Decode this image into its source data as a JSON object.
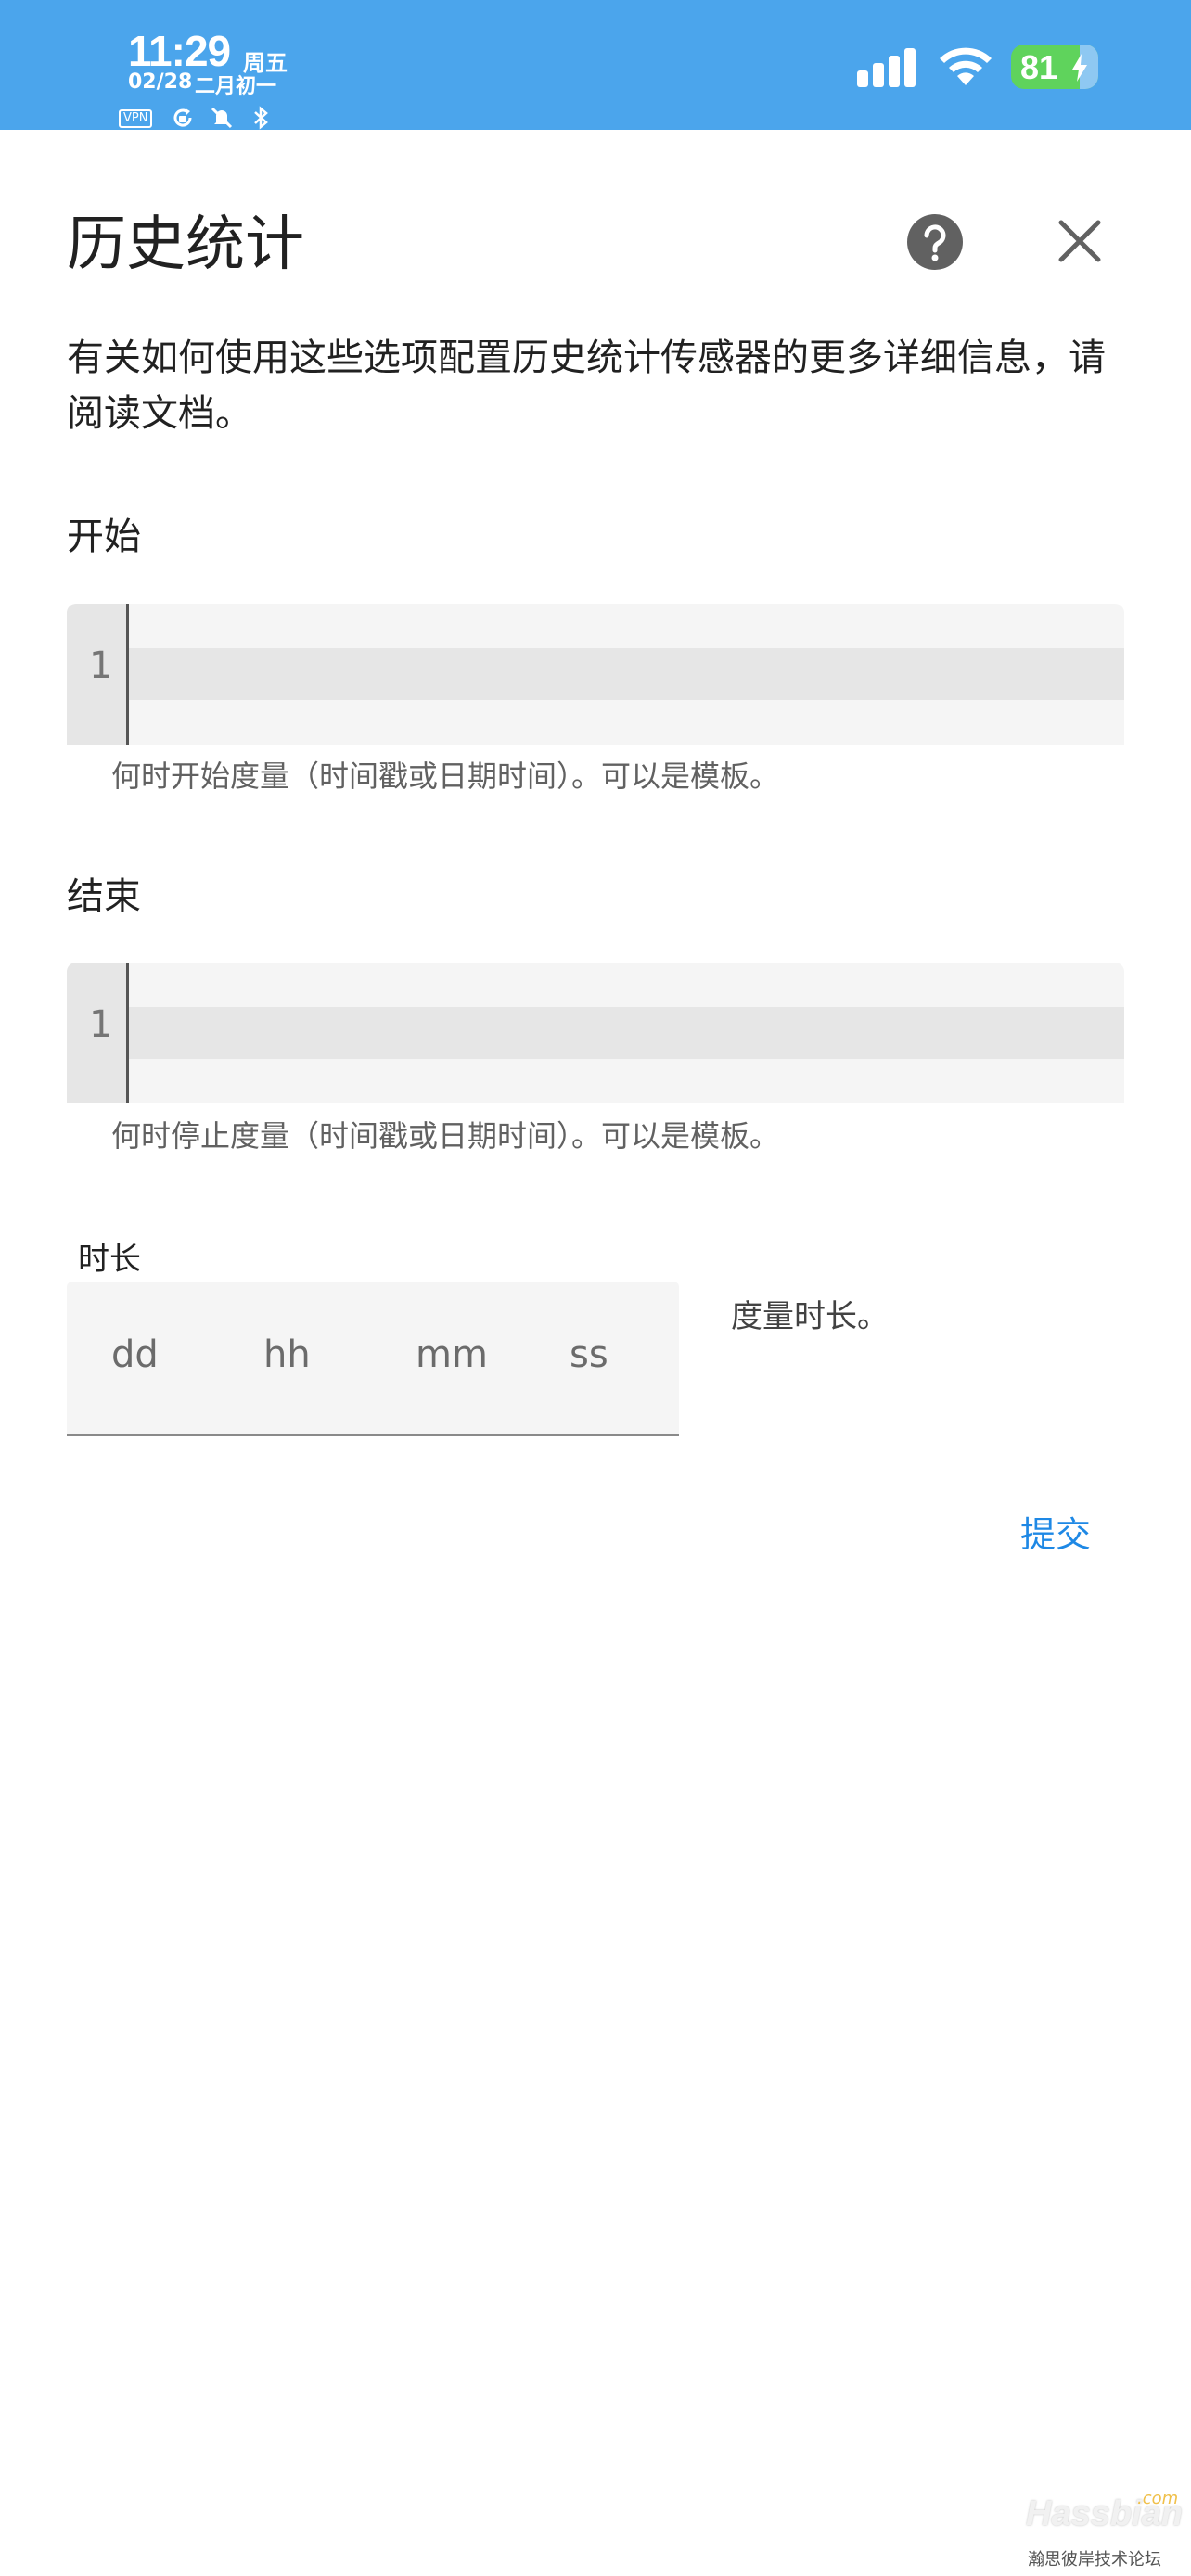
{
  "status_bar": {
    "time": "11:29",
    "weekday": "周五",
    "date": "02/28",
    "lunar": "二月初一",
    "vpn": "VPN",
    "battery": "81",
    "icons": [
      "vpn-icon",
      "rotation-lock-icon",
      "mute-icon",
      "bluetooth-icon",
      "signal-icon",
      "wifi-icon",
      "battery-charging-icon"
    ],
    "color": "#4ba5ec"
  },
  "dialog": {
    "title": "历史统计",
    "help_icon": "help-circle-icon",
    "close_icon": "close-icon",
    "description": "有关如何使用这些选项配置历史统计传感器的更多详细信息，请阅读文档。",
    "start": {
      "label": "开始",
      "line_number": "1",
      "helper": "何时开始度量（时间戳或日期时间）。可以是模板。"
    },
    "end": {
      "label": "结束",
      "line_number": "1",
      "helper": "何时停止度量（时间戳或日期时间）。可以是模板。"
    },
    "duration": {
      "label": "时长",
      "days": "dd",
      "hours": "hh",
      "minutes": "mm",
      "seconds": "ss",
      "helper": "度量时长。"
    },
    "submit": "提交",
    "accent_color": "#1e88e5"
  },
  "watermark": {
    "logo": "Hassbian",
    "com": ".com",
    "subtitle": "瀚思彼岸技术论坛"
  }
}
